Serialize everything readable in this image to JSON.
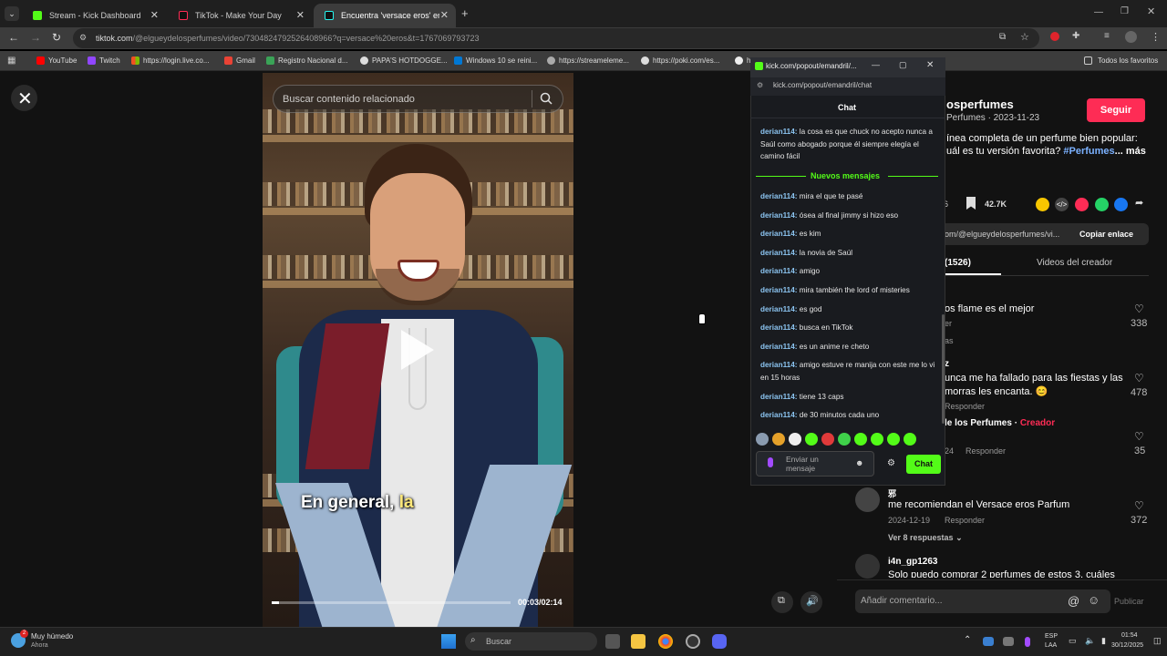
{
  "browser": {
    "tabs": [
      {
        "label": "Stream - Kick Dashboard",
        "icon": "kick-icon"
      },
      {
        "label": "TikTok - Make Your Day",
        "icon": "tiktok-icon"
      },
      {
        "label": "Encuentra 'versace eros' en Tik",
        "icon": "tiktok-icon"
      }
    ],
    "url_host": "tiktok.com",
    "url_path": "/@elgueydelosperfumes/video/7304824792526408966?q=versace%20eros&t=1767069793723",
    "bookmarks": [
      "YouTube",
      "Twitch",
      "https://login.live.co...",
      "Gmail",
      "Registro Nacional d...",
      "PAPA'S HOTDOGGE...",
      "Windows 10 se reini...",
      "https://streameleme...",
      "https://poki.com/es...",
      "h"
    ],
    "bookmarks_folder": "Todos los favoritos"
  },
  "video": {
    "search_placeholder": "Buscar contenido relacionado",
    "subtitle_main": "En general, ",
    "subtitle_highlight": "la",
    "time": "00:03/02:14",
    "progress_fraction": 0.03
  },
  "kick": {
    "window_url": "kick.com/popout/emandril/...",
    "address": "kick.com/popout/emandril/chat",
    "header": "Chat",
    "new_messages_label": "Nuevos mensajes",
    "first_message": {
      "user": "derian114:",
      "text": "la cosa es que chuck no acepto nunca a Saúl como abogado porque él siempre elegía el camino fácil"
    },
    "messages": [
      {
        "user": "derian114:",
        "text": "mira el que te pasé"
      },
      {
        "user": "derian114:",
        "text": "ósea al final jimmy si hizo eso"
      },
      {
        "user": "derian114:",
        "text": "es kim"
      },
      {
        "user": "derian114:",
        "text": "la novia de Saúl"
      },
      {
        "user": "derian114:",
        "text": "amigo"
      },
      {
        "user": "derian114:",
        "text": "mira también the lord of misteries"
      },
      {
        "user": "derian114:",
        "text": "es god"
      },
      {
        "user": "derian114:",
        "text": "busca en TikTok"
      },
      {
        "user": "derian114:",
        "text": "es un anime re cheto"
      },
      {
        "user": "derian114:",
        "text": "amigo estuve re manija con este me lo vi en 15 horas"
      },
      {
        "user": "derian114:",
        "text": "tiene 13 caps"
      },
      {
        "user": "derian114:",
        "text": "de 30 minutos cada uno"
      }
    ],
    "input_placeholder": "Enviar un mensaje",
    "send_label": "Chat"
  },
  "tiktok": {
    "author": "osperfumes",
    "author_sub": "Perfumes · 2023-11-23",
    "follow_label": "Seguir",
    "desc_line1": "ínea completa de un perfume bien popular:",
    "desc_line2": "uál es tu versión favorita? ",
    "desc_hashtag": "#Perfumes",
    "desc_more": "... más",
    "count_left": "6",
    "saves": "42.7K",
    "link_text": "om/@elgueydelosperfumes/vi...",
    "copy_label": "Copiar enlace",
    "tab_comments": "(1526)",
    "tab_creator": "Videos del creador",
    "comments": [
      {
        "text": "os flame es el mejor",
        "meta": "er",
        "likes": "338",
        "extra": "as"
      },
      {
        "user": "z",
        "text": "unca me ha fallado para las fiestas y las",
        "text2": " morras les encanta. 😊",
        "reply": "Responder",
        "likes": "478"
      },
      {
        "user": "le los Perfumes",
        "creator": "Creador",
        "date": "24",
        "reply": "Responder",
        "likes": "35"
      },
      {
        "user": "邪",
        "text": "me recomiendan el Versace eros Parfum",
        "date": "2024-12-19",
        "reply": "Responder",
        "likes": "372",
        "replies": "Ver 8 respuestas"
      },
      {
        "user": "i4n_gp1263",
        "text": "Solo puedo comprar 2 perfumes de estos 3, cuáles"
      }
    ],
    "comment_placeholder": "Añadir comentario...",
    "publish_label": "Publicar"
  },
  "taskbar": {
    "weather": "Muy húmedo",
    "weather_sub": "Ahora",
    "weather_badge": "2",
    "search": "Buscar",
    "lang": "ESP",
    "lang2": "LAA",
    "time": "01:54",
    "date": "30/12/2025"
  }
}
